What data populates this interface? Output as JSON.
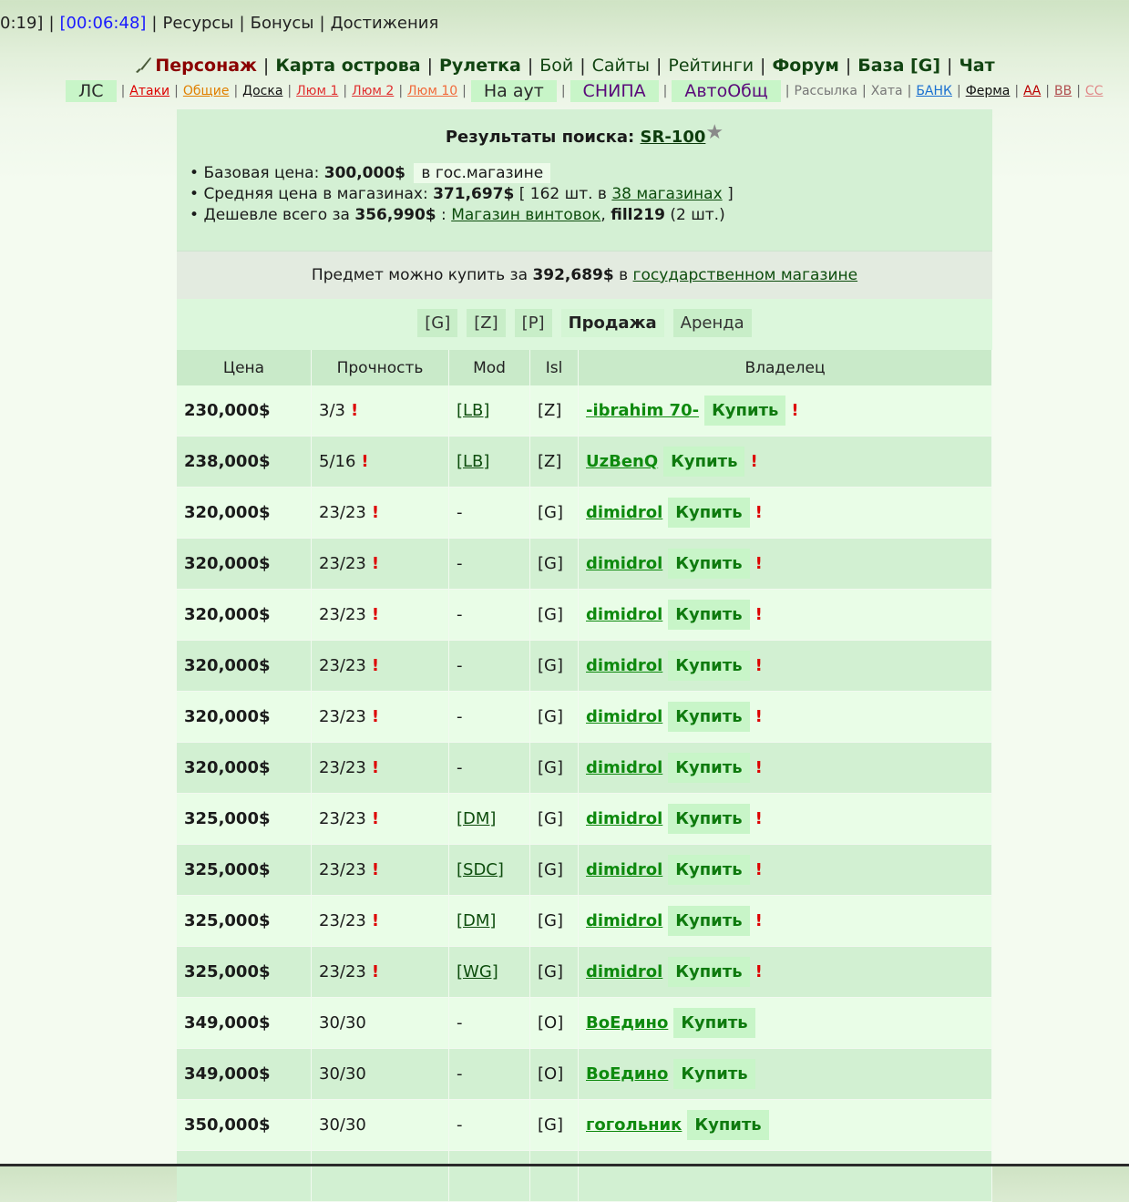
{
  "topbar": {
    "time1": "0:19]",
    "time2": "[00:06:48]",
    "links": [
      "Ресурсы",
      "Бонусы",
      "Достижения"
    ]
  },
  "mainnav": {
    "character": "Персонаж",
    "items": [
      "Карта острова",
      "Рулетка",
      "Бой",
      "Сайты",
      "Рейтинги",
      "Форум",
      "База [G]",
      "Чат"
    ]
  },
  "subnav": {
    "ls": "ЛС",
    "attacks": "Атаки",
    "general": "Общие",
    "board": "Доска",
    "lum1": "Люм 1",
    "lum2": "Люм 2",
    "lum10": "Люм 10",
    "naout": "На аут",
    "snipa": "СНИПА",
    "autoob": "АвтоОбщ",
    "mailing": "Рассылка",
    "hata": "Хата",
    "bank": "БАНК",
    "farm": "Ферма",
    "aa": "АА",
    "bb": "ВВ",
    "cc": "СС"
  },
  "search": {
    "title_prefix": "Результаты поиска:",
    "item": "SR-100",
    "base_label": "Базовая цена:",
    "base_price": "300,000$",
    "base_where": "в гос.магазине",
    "avg_label": "Средняя цена в магазинах:",
    "avg_price": "371,697$",
    "avg_open": "[ 162 шт. в",
    "avg_shops": "38 магазинах",
    "avg_close": "]",
    "cheap_label": "Дешевле всего за",
    "cheap_price": "356,990$",
    "cheap_colon": ":",
    "cheap_shop": "Магазин винтовок",
    "cheap_owner": "fill219",
    "cheap_qty": "(2 шт.)"
  },
  "note": {
    "prefix": "Предмет можно купить за",
    "price": "392,689$",
    "mid": "в",
    "link": "государственном магазине"
  },
  "tabs": [
    "[G]",
    "[Z]",
    "[P]",
    "Продажа",
    "Аренда"
  ],
  "table": {
    "headers": [
      "Цена",
      "Прочность",
      "Mod",
      "Isl",
      "Владелец"
    ],
    "buy_label": "Купить",
    "rows": [
      {
        "price": "230,000$",
        "dur": "3/3",
        "mod": "[LB]",
        "isl": "[Z]",
        "owner": "-ibrahim 70-",
        "warn": true
      },
      {
        "price": "238,000$",
        "dur": "5/16",
        "mod": "[LB]",
        "isl": "[Z]",
        "owner": "UzBenQ",
        "warn": true
      },
      {
        "price": "320,000$",
        "dur": "23/23",
        "mod": "-",
        "isl": "[G]",
        "owner": "dimidrol",
        "warn": true
      },
      {
        "price": "320,000$",
        "dur": "23/23",
        "mod": "-",
        "isl": "[G]",
        "owner": "dimidrol",
        "warn": true
      },
      {
        "price": "320,000$",
        "dur": "23/23",
        "mod": "-",
        "isl": "[G]",
        "owner": "dimidrol",
        "warn": true
      },
      {
        "price": "320,000$",
        "dur": "23/23",
        "mod": "-",
        "isl": "[G]",
        "owner": "dimidrol",
        "warn": true
      },
      {
        "price": "320,000$",
        "dur": "23/23",
        "mod": "-",
        "isl": "[G]",
        "owner": "dimidrol",
        "warn": true
      },
      {
        "price": "320,000$",
        "dur": "23/23",
        "mod": "-",
        "isl": "[G]",
        "owner": "dimidrol",
        "warn": true
      },
      {
        "price": "325,000$",
        "dur": "23/23",
        "mod": "[DM]",
        "isl": "[G]",
        "owner": "dimidrol",
        "warn": true
      },
      {
        "price": "325,000$",
        "dur": "23/23",
        "mod": "[SDC]",
        "isl": "[G]",
        "owner": "dimidrol",
        "warn": true
      },
      {
        "price": "325,000$",
        "dur": "23/23",
        "mod": "[DM]",
        "isl": "[G]",
        "owner": "dimidrol",
        "warn": true
      },
      {
        "price": "325,000$",
        "dur": "23/23",
        "mod": "[WG]",
        "isl": "[G]",
        "owner": "dimidrol",
        "warn": true
      },
      {
        "price": "349,000$",
        "dur": "30/30",
        "mod": "-",
        "isl": "[O]",
        "owner": "ВоЕдино",
        "warn": false
      },
      {
        "price": "349,000$",
        "dur": "30/30",
        "mod": "-",
        "isl": "[O]",
        "owner": "ВоЕдино",
        "warn": false
      },
      {
        "price": "350,000$",
        "dur": "30/30",
        "mod": "-",
        "isl": "[G]",
        "owner": "гогольник",
        "warn": false
      },
      {
        "price": "",
        "dur": "",
        "mod": "",
        "isl": "",
        "owner": "",
        "warn": false
      }
    ]
  }
}
